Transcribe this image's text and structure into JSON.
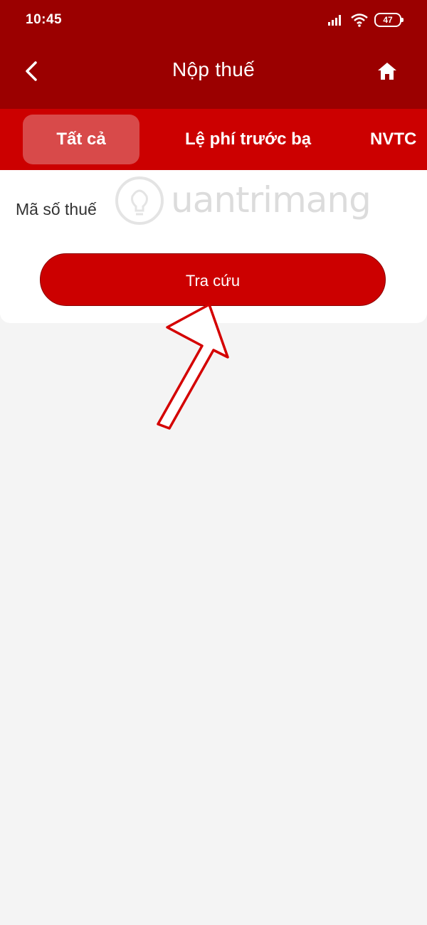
{
  "status_bar": {
    "time": "10:45",
    "battery": "47",
    "icons": [
      "signal-icon",
      "wifi-icon",
      "battery-icon"
    ]
  },
  "header": {
    "title": "Nộp thuế",
    "back_icon": "chevron-left-icon",
    "home_icon": "home-icon"
  },
  "tabs": [
    {
      "label": "Tất cả",
      "selected": true
    },
    {
      "label": "Lệ phí trước bạ",
      "selected": false
    },
    {
      "label": "NVTC",
      "selected": false
    }
  ],
  "form": {
    "tax_code_label": "Mã số thuế",
    "tax_code_value": "",
    "search_label": "Tra cứu"
  },
  "watermark": {
    "text": "uantrimang"
  },
  "colors": {
    "header_bg": "#9b0000",
    "tabs_bg": "#cc0000",
    "selected_tab_bg": "#d84a4a",
    "button_bg": "#cc0000",
    "page_bg": "#f4f4f4"
  }
}
